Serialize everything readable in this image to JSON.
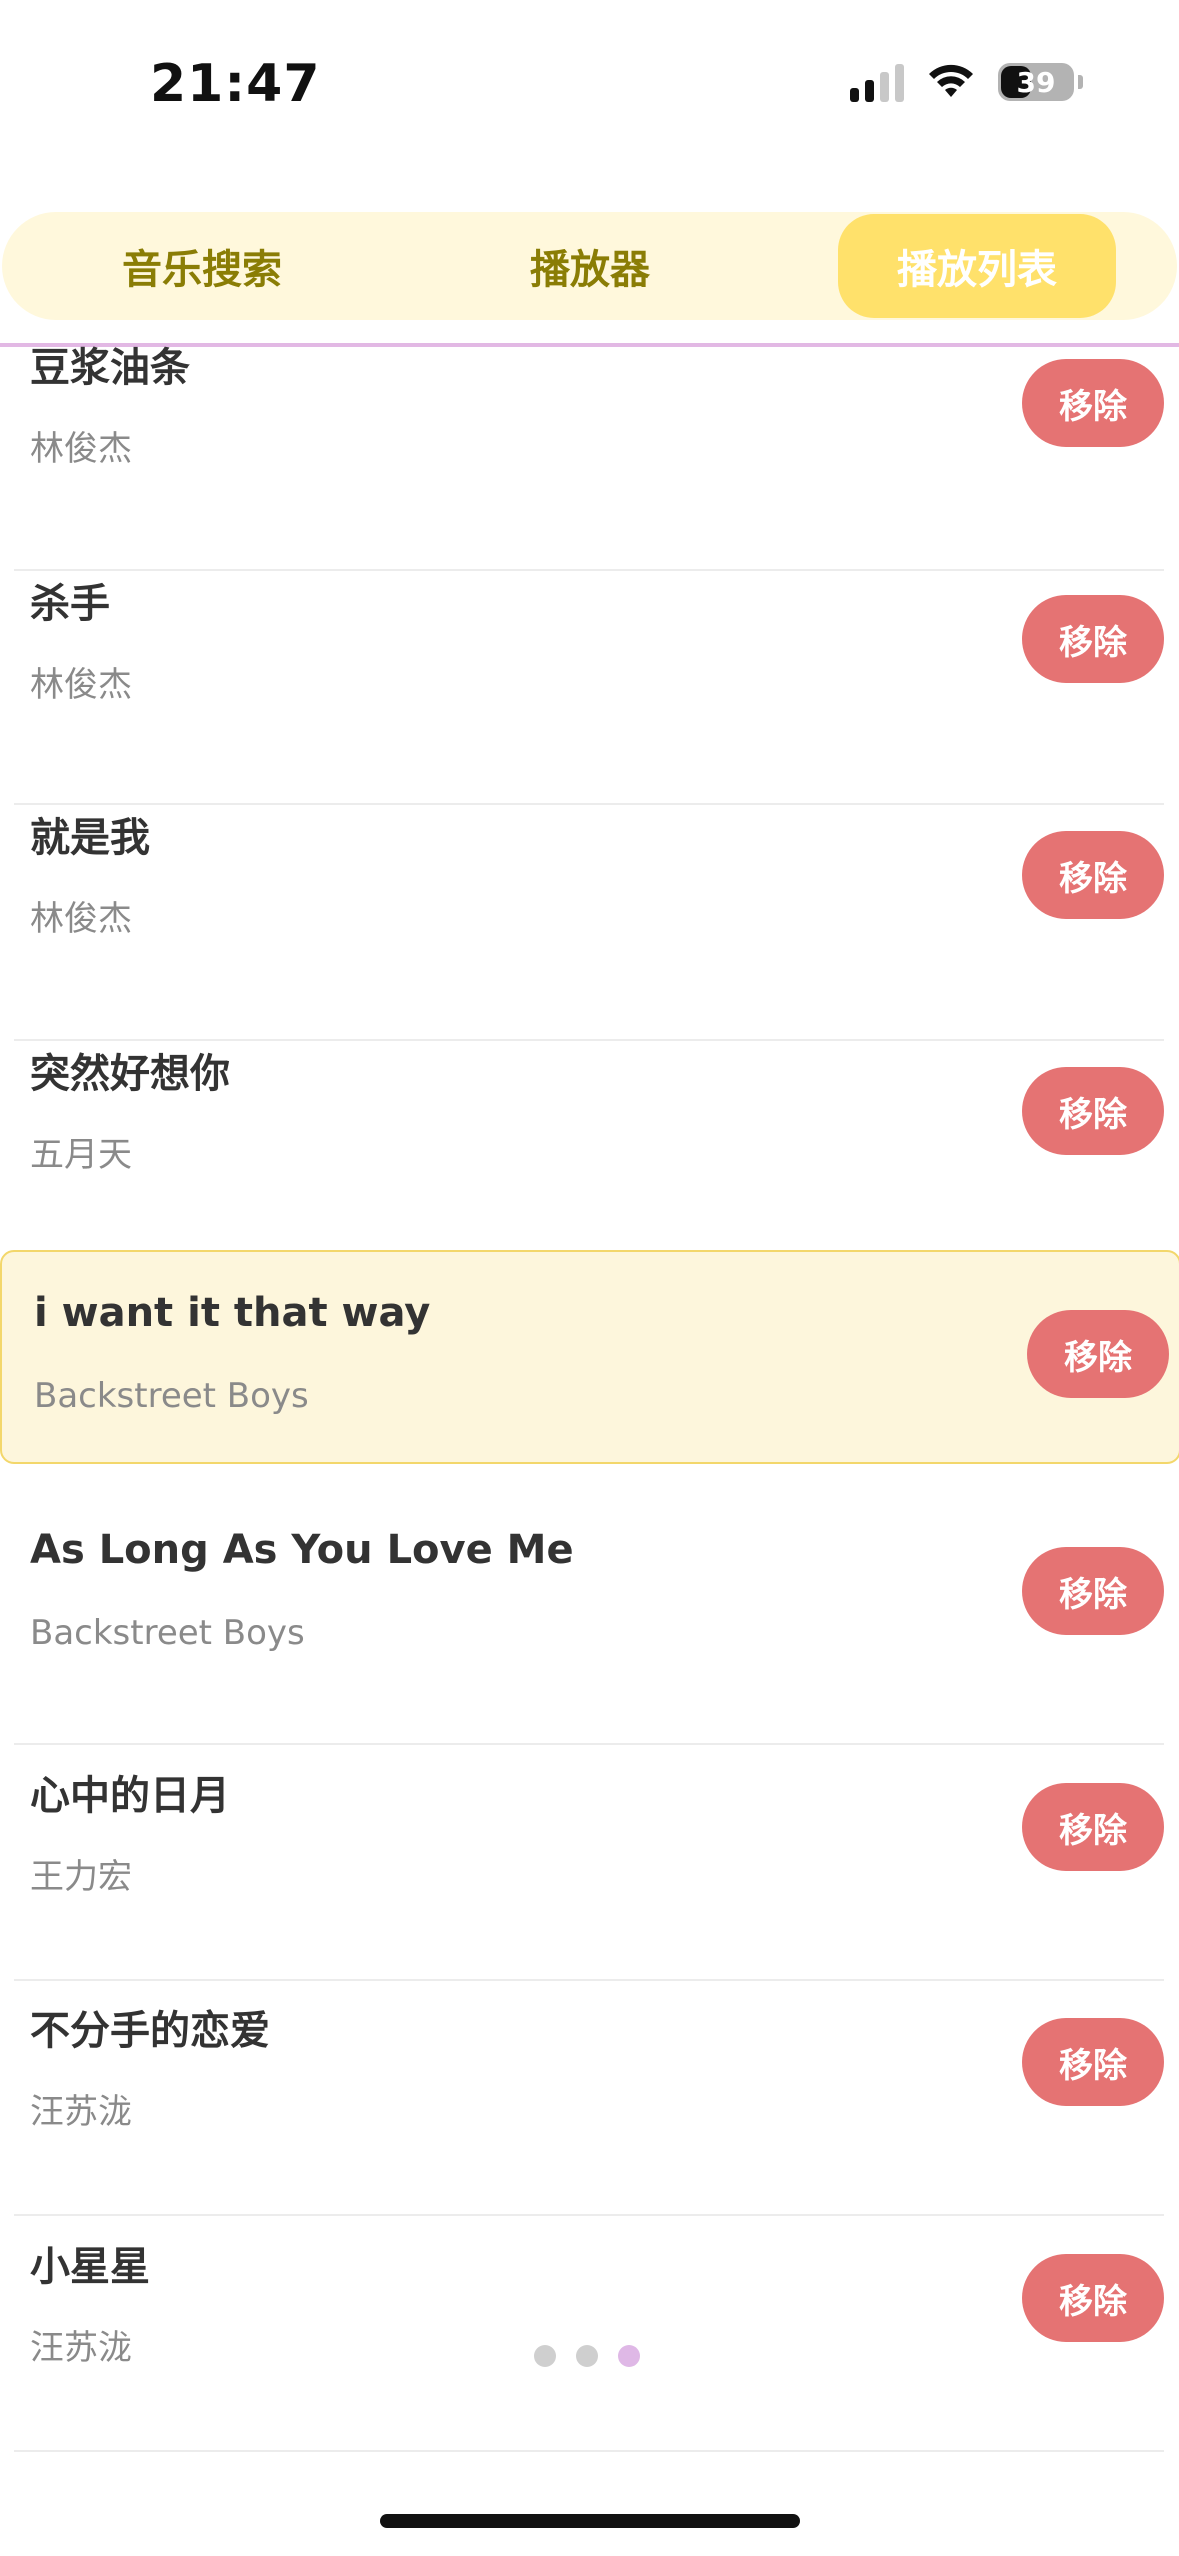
{
  "status_bar": {
    "time": "21:47",
    "battery_level": "39",
    "icons": [
      "cellular-signal-icon",
      "wifi-icon",
      "battery-icon"
    ]
  },
  "tabs": [
    {
      "label": "音乐搜索",
      "active": false
    },
    {
      "label": "播放器",
      "active": false
    },
    {
      "label": "播放列表",
      "active": true
    }
  ],
  "playlist": [
    {
      "title": "豆浆油条",
      "artist": "林俊杰",
      "action": "移除",
      "playing": false
    },
    {
      "title": "杀手",
      "artist": "林俊杰",
      "action": "移除",
      "playing": false
    },
    {
      "title": "就是我",
      "artist": "林俊杰",
      "action": "移除",
      "playing": false
    },
    {
      "title": "突然好想你",
      "artist": "五月天",
      "action": "移除",
      "playing": false
    },
    {
      "title": "i want it that way",
      "artist": "Backstreet Boys",
      "action": "移除",
      "playing": true
    },
    {
      "title": "As Long As You Love Me",
      "artist": "Backstreet Boys",
      "action": "移除",
      "playing": false
    },
    {
      "title": "心中的日月",
      "artist": "王力宏",
      "action": "移除",
      "playing": false
    },
    {
      "title": "不分手的恋爱",
      "artist": "汪苏泷",
      "action": "移除",
      "playing": false
    },
    {
      "title": "小星星",
      "artist": "汪苏泷",
      "action": "移除",
      "playing": false
    }
  ],
  "pagination": {
    "total": 3,
    "current": 3
  },
  "colors": {
    "accent": "#ffe16b",
    "tab_text": "#8a7d05",
    "remove_button": "#e57373",
    "active_row_bg": "#fdf6dc",
    "active_dot": "#dfb8e6"
  }
}
